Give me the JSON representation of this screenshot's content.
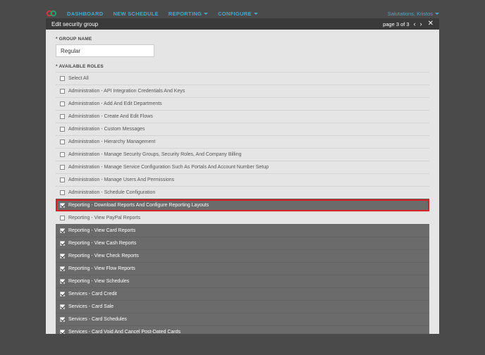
{
  "nav": {
    "items": [
      "DASHBOARD",
      "NEW SCHEDULE",
      "REPORTING",
      "CONFIGURE"
    ]
  },
  "user": {
    "greeting": "Salutations, Kristos"
  },
  "modal": {
    "title": "Edit security group",
    "pager": "page 3 of 3"
  },
  "form": {
    "group_name_label": "* GROUP NAME",
    "group_name_value": "Regular",
    "roles_label": "* AVAILABLE ROLES"
  },
  "roles": [
    {
      "label": "Select All",
      "checked": false,
      "dark": false,
      "highlighted": false
    },
    {
      "label": "Administration - API Integration Credentials And Keys",
      "checked": false,
      "dark": false,
      "highlighted": false
    },
    {
      "label": "Administration - Add And Edit Departments",
      "checked": false,
      "dark": false,
      "highlighted": false
    },
    {
      "label": "Administration - Create And Edit Flows",
      "checked": false,
      "dark": false,
      "highlighted": false
    },
    {
      "label": "Administration - Custom Messages",
      "checked": false,
      "dark": false,
      "highlighted": false
    },
    {
      "label": "Administration - Hierarchy Management",
      "checked": false,
      "dark": false,
      "highlighted": false
    },
    {
      "label": "Administration - Manage Security Groups, Security Roles, And Company Billing",
      "checked": false,
      "dark": false,
      "highlighted": false
    },
    {
      "label": "Administration - Manage Service Configuration Such As Portals And Account Number Setup",
      "checked": false,
      "dark": false,
      "highlighted": false
    },
    {
      "label": "Administration - Manage Users And Permissions",
      "checked": false,
      "dark": false,
      "highlighted": false
    },
    {
      "label": "Administration - Schedule Configuration",
      "checked": false,
      "dark": false,
      "highlighted": false
    },
    {
      "label": "Reporting - Download Reports And Configure Reporting Layouts",
      "checked": true,
      "dark": true,
      "highlighted": true
    },
    {
      "label": "Reporting - View PayPal Reports",
      "checked": false,
      "dark": false,
      "highlighted": false
    },
    {
      "label": "Reporting - View Card Reports",
      "checked": true,
      "dark": true,
      "highlighted": false
    },
    {
      "label": "Reporting - View Cash Reports",
      "checked": true,
      "dark": true,
      "highlighted": false
    },
    {
      "label": "Reporting - View Check Reports",
      "checked": true,
      "dark": true,
      "highlighted": false
    },
    {
      "label": "Reporting - View Flow Reports",
      "checked": true,
      "dark": true,
      "highlighted": false
    },
    {
      "label": "Reporting - View Schedules",
      "checked": true,
      "dark": true,
      "highlighted": false
    },
    {
      "label": "Services - Card Credit",
      "checked": true,
      "dark": true,
      "highlighted": false
    },
    {
      "label": "Services - Card Sale",
      "checked": true,
      "dark": true,
      "highlighted": false
    },
    {
      "label": "Services - Card Schedules",
      "checked": true,
      "dark": true,
      "highlighted": false
    },
    {
      "label": "Services - Card Void And Cancel Post-Dated Cards",
      "checked": true,
      "dark": true,
      "highlighted": false
    }
  ]
}
